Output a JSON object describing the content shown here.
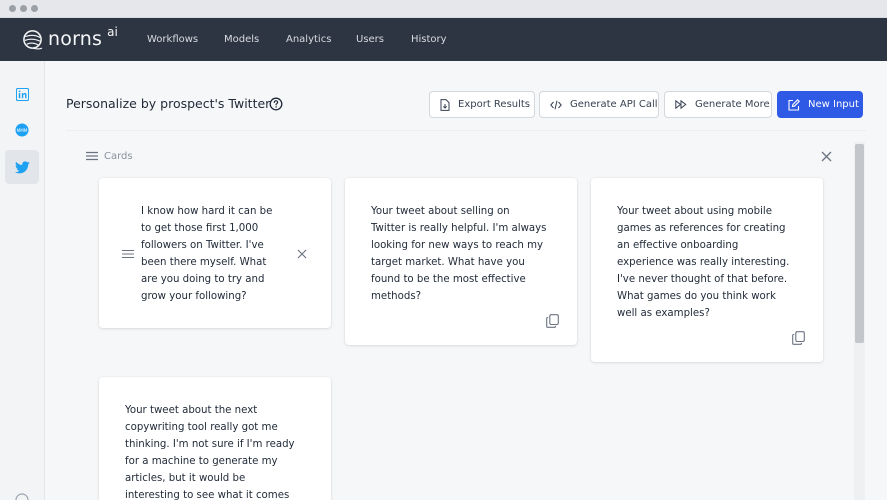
{
  "brand": {
    "name": "norns",
    "suffix": "ai"
  },
  "nav": {
    "items": [
      {
        "label": "Workflows"
      },
      {
        "label": "Models"
      },
      {
        "label": "Analytics"
      },
      {
        "label": "Users"
      },
      {
        "label": "History"
      }
    ]
  },
  "sidebar": {
    "items": [
      {
        "icon": "linkedin-icon",
        "color": "#1da1f2"
      },
      {
        "icon": "mmm-icon",
        "color": "#1da1f2"
      },
      {
        "icon": "twitter-icon",
        "color": "#1da1f2",
        "active": true
      }
    ]
  },
  "header": {
    "title": "Personalize by prospect's Twitter",
    "buttons": {
      "export": "Export Results",
      "api": "Generate API Call",
      "more": "Generate More",
      "new_input": "New Input"
    }
  },
  "panel": {
    "label": "Cards"
  },
  "cards": [
    {
      "lines": [
        "I know how hard it can be",
        "to get those first 1,000",
        "followers on Twitter. I've",
        "been there myself. What",
        "are you doing to try and",
        "grow your following?"
      ]
    },
    {
      "lines": [
        "Your tweet about selling on",
        "Twitter is really helpful. I'm always",
        "looking for new ways to reach my",
        "target market. What have you",
        "found to be the most effective",
        "methods?"
      ]
    },
    {
      "lines": [
        "Your tweet about using mobile",
        "games as references for creating",
        "an effective onboarding",
        "experience was really interesting.",
        "I've never thought of that before.",
        "What games do you think work",
        "well as examples?"
      ]
    },
    {
      "lines": [
        "Your tweet about the next",
        "copywriting tool really got me",
        "thinking. I'm not sure if I'm ready",
        "for a machine to generate my",
        "articles, but it would be",
        "interesting to see what it comes"
      ]
    }
  ],
  "colors": {
    "navbar": "#2d3542",
    "primary": "#2f5ae6",
    "twitter": "#1da1f2"
  }
}
